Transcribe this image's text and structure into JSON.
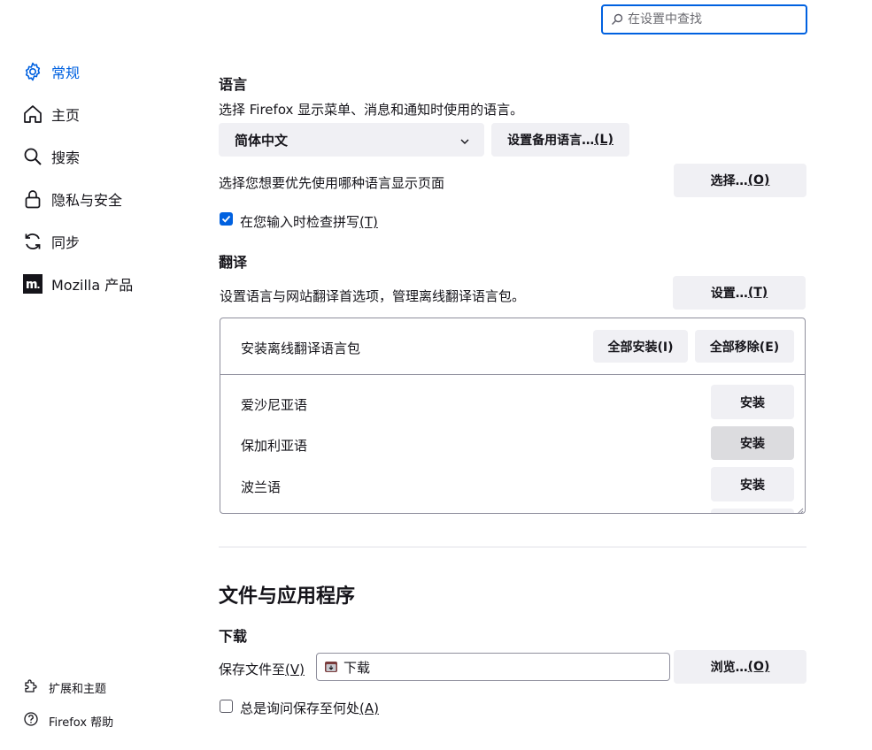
{
  "search": {
    "placeholder": "在设置中查找"
  },
  "sidebar": {
    "items": [
      {
        "label": "常规",
        "icon": "gear-icon",
        "active": true
      },
      {
        "label": "主页",
        "icon": "home-icon"
      },
      {
        "label": "搜索",
        "icon": "search-icon"
      },
      {
        "label": "隐私与安全",
        "icon": "lock-icon"
      },
      {
        "label": "同步",
        "icon": "sync-icon"
      },
      {
        "label": "Mozilla 产品",
        "icon": "mozilla-icon"
      }
    ],
    "footer": [
      {
        "label": "扩展和主题",
        "icon": "puzzle-icon"
      },
      {
        "label": "Firefox 帮助",
        "icon": "help-icon"
      }
    ]
  },
  "language": {
    "heading": "语言",
    "description": "选择 Firefox 显示菜单、消息和通知时使用的语言。",
    "selected": "简体中文",
    "alt_button": "设置备用语言…",
    "alt_key": "(L)",
    "page_lang_text": "选择您想要优先使用哪种语言显示页面",
    "choose_button": "选择…",
    "choose_key": "(O)",
    "spellcheck_label": "在您输入时检查拼写",
    "spellcheck_key": "(T)"
  },
  "translation": {
    "heading": "翻译",
    "description": "设置语言与网站翻译首选项，管理离线翻译语言包。",
    "settings_button": "设置…",
    "settings_key": "(T)",
    "packs_label": "安装离线翻译语言包",
    "install_all": "全部安装(I)",
    "remove_all": "全部移除(E)",
    "languages": [
      {
        "name": "爱沙尼亚语",
        "action": "安装"
      },
      {
        "name": "保加利亚语",
        "action": "安装"
      },
      {
        "name": "波兰语",
        "action": "安装"
      }
    ]
  },
  "files": {
    "heading": "文件与应用程序",
    "downloads_heading": "下载",
    "save_to_label": "保存文件至",
    "save_to_key": "(V)",
    "folder": "下载",
    "browse_button": "浏览…",
    "browse_key": "(O)",
    "always_ask_label": "总是询问保存至何处",
    "always_ask_key": "(A)"
  },
  "colors": {
    "accent": "#0061e0",
    "button_bg": "#f0f0f4",
    "text": "#15141a"
  }
}
